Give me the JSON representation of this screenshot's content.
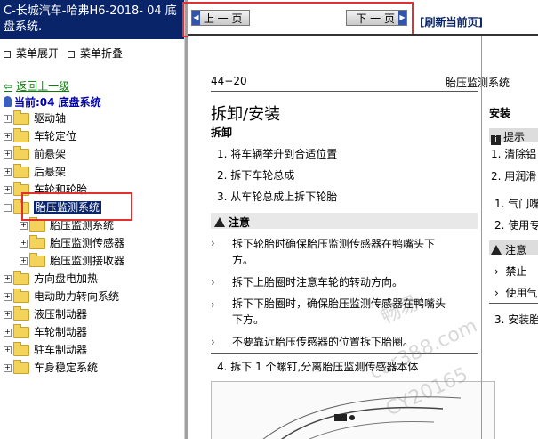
{
  "window_title": "C-长城汽车-哈弗H6-2018- 04 底盘系统.",
  "menu": {
    "expand": "菜单展开",
    "collapse": "菜单折叠"
  },
  "back_link": "返回上一级",
  "current": "当前:04 底盘系统",
  "tree": [
    {
      "label": "驱动轴",
      "indent": 0
    },
    {
      "label": "车轮定位",
      "indent": 0
    },
    {
      "label": "前悬架",
      "indent": 0
    },
    {
      "label": "后悬架",
      "indent": 0
    },
    {
      "label": "车轮和轮胎",
      "indent": 0
    },
    {
      "label": "胎压监测系统",
      "indent": 0,
      "selected": true
    },
    {
      "label": "胎压监测系统",
      "indent": 1
    },
    {
      "label": "胎压监测传感器",
      "indent": 1
    },
    {
      "label": "胎压监测接收器",
      "indent": 1
    },
    {
      "label": "方向盘电加热",
      "indent": 0
    },
    {
      "label": "电动助力转向系统",
      "indent": 0
    },
    {
      "label": "液压制动器",
      "indent": 0
    },
    {
      "label": "车轮制动器",
      "indent": 0
    },
    {
      "label": "驻车制动器",
      "indent": 0
    },
    {
      "label": "车身稳定系统",
      "indent": 0
    }
  ],
  "nav": {
    "prev": "上 一 页",
    "next": "下 一 页",
    "refresh": "[刷新当前页]"
  },
  "doc": {
    "page_number": "44−20",
    "header": "胎压监测系统",
    "section_title": "拆卸/安装",
    "sub_title": "拆卸",
    "steps": [
      "1. 将车辆举升到合适位置",
      "2. 拆下车轮总成",
      "3. 从车轮总成上拆下轮胎"
    ],
    "caution_label": "注意",
    "cautions": [
      "拆下轮胎时确保胎压监测传感器在鸭嘴头下",
      "方。",
      "拆下上胎圈时注意车轮的转动方向。",
      "拆下下胎圈时，确保胎压监测传感器在鸭嘴头",
      "下方。",
      "不要靠近胎压传感器的位置拆下胎圈。"
    ],
    "step4": "4. 拆下 1 个螺钉,分离胎压监测传感器本体",
    "right": {
      "install": "安装",
      "tip_label": "提示",
      "r1": "1.  清除铝",
      "r2": "2.  用润滑",
      "r3": "1.  气门嘴",
      "r4": "2.  使用专",
      "caution_label": "注意",
      "r5": "禁止",
      "r6": "使用气",
      "r7": "3.  安装胎"
    }
  },
  "watermark": [
    "畅易",
    "car388.com",
    "CY20165"
  ]
}
